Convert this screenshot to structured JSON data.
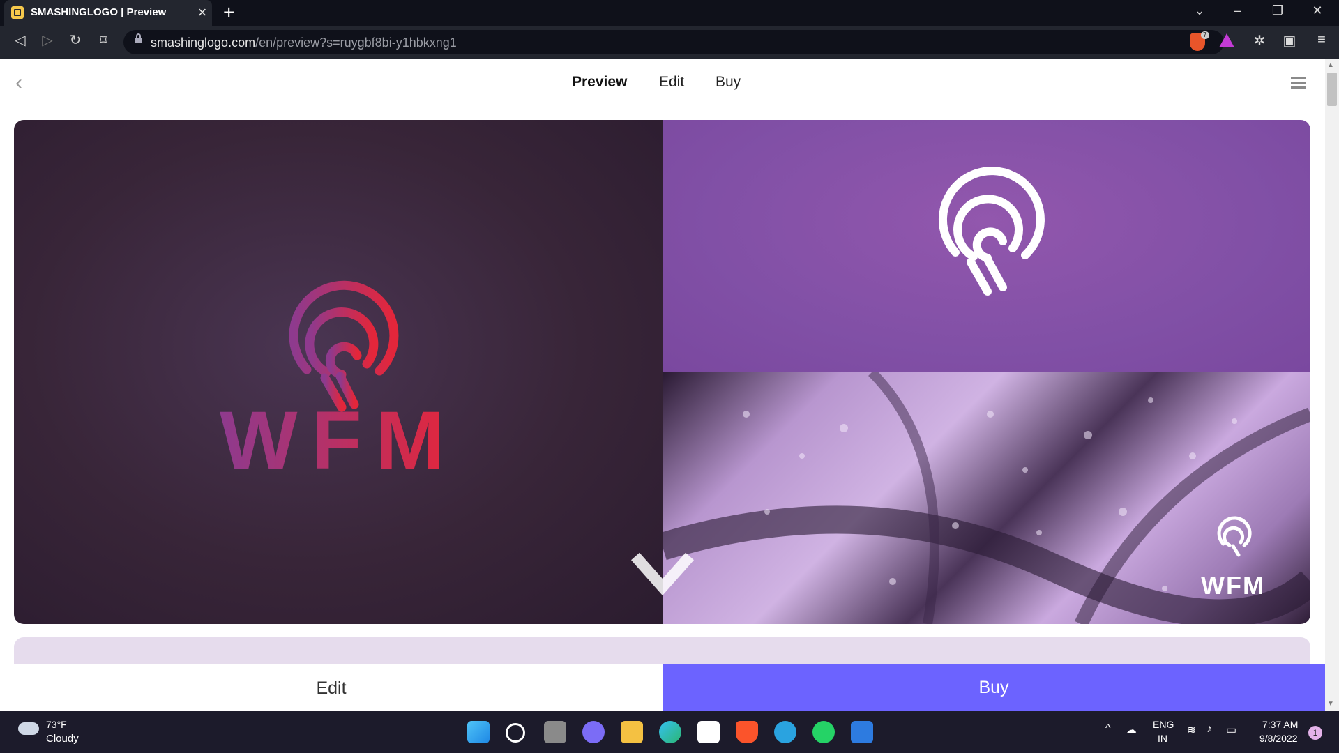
{
  "browser": {
    "tab_title": "SMASHINGLOGO | Preview",
    "tab_close": "×",
    "new_tab": "+",
    "url_domain": "smashinglogo.com",
    "url_path": "/en/preview?s=ruygbf8bi-y1hbkxng1",
    "shield_count": "7",
    "window_controls": [
      "⌄",
      "–",
      "❐",
      "✕"
    ]
  },
  "site_nav": {
    "back": "‹",
    "links": [
      "Preview",
      "Edit",
      "Buy"
    ],
    "active": "Preview"
  },
  "logo": {
    "wordmark": "WFM",
    "gradient_start": "#8e3a8e",
    "gradient_end": "#e4263a",
    "mark_color_light": "#ffffff"
  },
  "colors": {
    "left_panel": "#382538",
    "right_top_panel": "#8150a6",
    "buy_button": "#6c63ff",
    "taskbar": "#1c1b2b"
  },
  "actions": {
    "edit_label": "Edit",
    "buy_label": "Buy"
  },
  "taskbar": {
    "weather_temp": "73°F",
    "weather_desc": "Cloudy",
    "apps": [
      "windows-start-icon",
      "search-icon",
      "task-view-icon",
      "chat-icon",
      "file-explorer-icon",
      "edge-icon",
      "store-icon",
      "brave-icon",
      "telegram-icon",
      "whatsapp-icon",
      "media-player-icon"
    ],
    "tray_caret": "^",
    "lang_line1": "ENG",
    "lang_line2": "IN",
    "time": "7:37 AM",
    "date": "9/8/2022",
    "notifications": "1"
  }
}
